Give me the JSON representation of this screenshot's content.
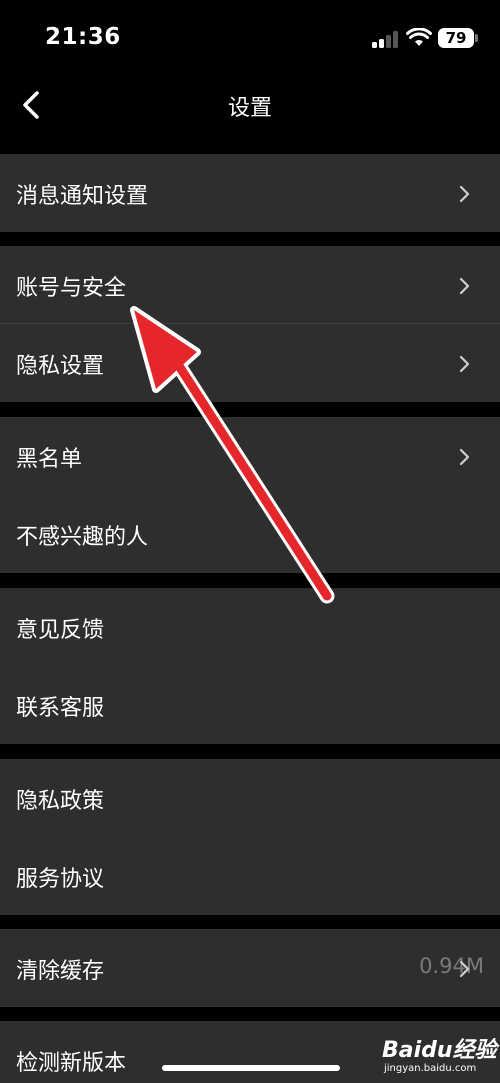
{
  "status_bar": {
    "time": "21:36",
    "battery": "79"
  },
  "nav": {
    "title": "设置"
  },
  "groups": [
    {
      "items": [
        {
          "label": "消息通知设置",
          "chevron": true
        }
      ]
    },
    {
      "items": [
        {
          "label": "账号与安全",
          "chevron": true
        },
        {
          "label": "隐私设置",
          "chevron": true
        }
      ]
    },
    {
      "items": [
        {
          "label": "黑名单",
          "chevron": true
        },
        {
          "label": "不感兴趣的人",
          "chevron": false
        }
      ]
    },
    {
      "items": [
        {
          "label": "意见反馈",
          "chevron": false
        },
        {
          "label": "联系客服",
          "chevron": false
        }
      ]
    },
    {
      "items": [
        {
          "label": "隐私政策",
          "chevron": false
        },
        {
          "label": "服务协议",
          "chevron": false
        }
      ]
    },
    {
      "items": [
        {
          "label": "清除缓存",
          "value": "0.94M",
          "chevron": true
        }
      ]
    },
    {
      "items": [
        {
          "label": "检测新版本",
          "chevron": false
        }
      ]
    }
  ],
  "watermark": {
    "brand": "Baidu经验",
    "url": "jingyan.baidu.com"
  },
  "colors": {
    "background": "#000000",
    "row": "#2e2e2e",
    "separator": "#3f3f3f",
    "annotation_arrow": "#e5262b"
  },
  "icons": {
    "back": "chevron-left-icon",
    "row_disclosure": "chevron-right-icon"
  }
}
